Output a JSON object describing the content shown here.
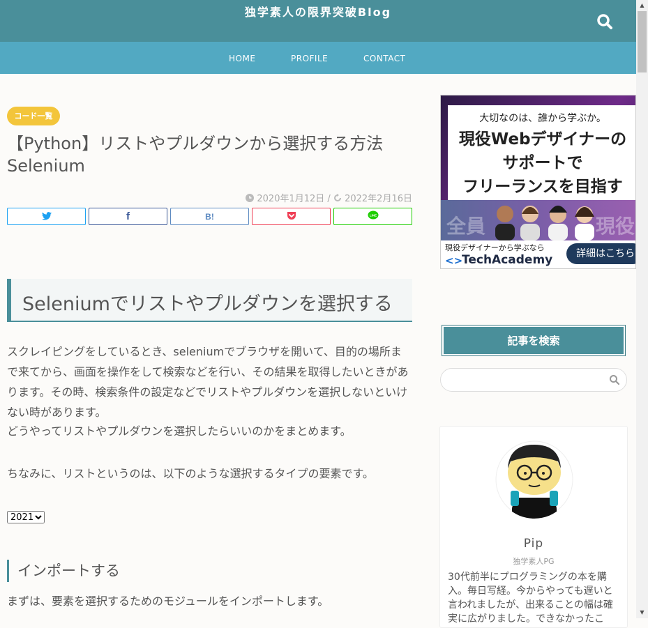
{
  "header": {
    "site_title": "独学素人の限界突破Blog",
    "search_icon": "search-icon"
  },
  "nav": {
    "items": [
      {
        "label": "HOME"
      },
      {
        "label": "PROFILE"
      },
      {
        "label": "CONTACT"
      }
    ]
  },
  "article": {
    "category": "コード一覧",
    "title": "【Python】リストやプルダウンから選択する方法Selenium",
    "published": "2020年1月12日",
    "updated": "2022年2月16日",
    "date_separator": "/",
    "share": [
      {
        "name": "twitter",
        "label": "twitter-icon",
        "color": "#1da1f2"
      },
      {
        "name": "facebook",
        "label": "f",
        "color": "#3b5998"
      },
      {
        "name": "hatena",
        "label": "B!",
        "color": "#5d8ac1"
      },
      {
        "name": "pocket",
        "label": "pocket-icon",
        "color": "#ef4056"
      },
      {
        "name": "line",
        "label": "LINE",
        "color": "#1dcd00"
      }
    ],
    "h2": "Seleniumでリストやプルダウンを選択する",
    "intro": "スクレイピングをしているとき、seleniumでブラウザを開いて、目的の場所まで来てから、画面を操作をして検索などを行い、その結果を取得したいときがあります。その時、検索条件の設定などでリストやプルダウンを選択しないといけない時があります。",
    "intro2": "どうやってリストやプルダウンを選択したらいいのかをまとめます。",
    "note": "ちなみに、リストというのは、以下のような選択するタイプの要素です。",
    "select_value": "2021",
    "h3": "インポートする",
    "import_text": "まずは、要素を選択するためのモジュールをインポートします。"
  },
  "sidebar": {
    "ad": {
      "tagline": "大切なのは、誰から学ぶか。",
      "headline": "現役Webデザイナーの\nサポートで\nフリーランスを目指す",
      "bg_left": "全員",
      "bg_right": "現役",
      "sub": "現役デザイナーから学ぶなら",
      "brand": "TechAcademy",
      "cta": "詳細はこちら"
    },
    "search": {
      "title": "記事を検索",
      "placeholder": ""
    },
    "profile": {
      "name": "Pip",
      "role": "独学素人PG",
      "bio": "30代前半にプログラミングの本を購入。毎日写経。今からやっても遅いと言われましたが、出来ることの幅は確実に広がりました。できなかったこ"
    }
  },
  "colors": {
    "header": "#4a8f9a",
    "nav": "#52a9c2",
    "badge": "#f3c53b",
    "accent": "#4a8f9a"
  }
}
